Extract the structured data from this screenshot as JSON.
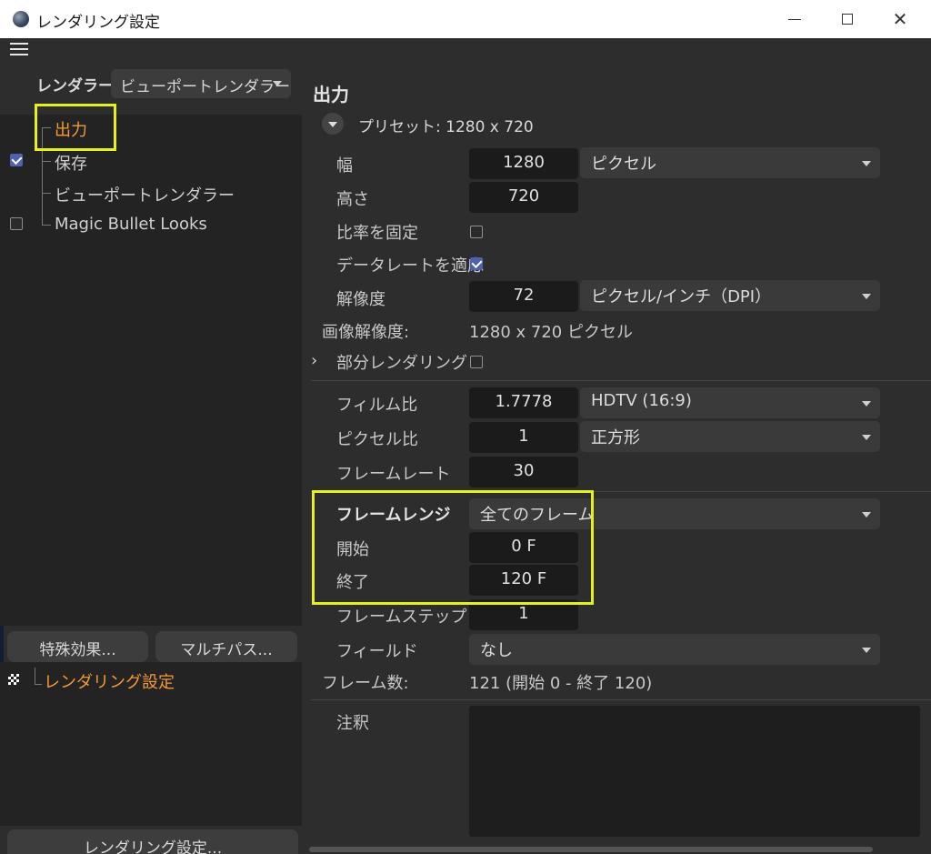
{
  "window": {
    "title": "レンダリング設定"
  },
  "renderer": {
    "label": "レンダラー",
    "value": "ビューポートレンダラー"
  },
  "tree": {
    "items": [
      {
        "label": "出力",
        "selected": true,
        "checkbox": null
      },
      {
        "label": "保存",
        "selected": false,
        "checkbox": true
      },
      {
        "label": "ビューポートレンダラー",
        "selected": false,
        "checkbox": null
      },
      {
        "label": "Magic Bullet Looks",
        "selected": false,
        "checkbox": false
      }
    ]
  },
  "left_buttons": {
    "effects": "特殊効果...",
    "multipass": "マルチパス..."
  },
  "lower_tree": {
    "item": "レンダリング設定"
  },
  "bottom_button": "レンダリング設定...",
  "output": {
    "title": "出力",
    "preset": "プリセット: 1280 x 720",
    "width": {
      "label": "幅",
      "value": "1280",
      "unit": "ピクセル"
    },
    "height": {
      "label": "高さ",
      "value": "720"
    },
    "lock_ratio": {
      "label": "比率を固定",
      "checked": false
    },
    "apply_datarate": {
      "label": "データレートを適応",
      "checked": true
    },
    "resolution": {
      "label": "解像度",
      "value": "72",
      "unit": "ピクセル/インチ（DPI）"
    },
    "image_resolution": {
      "label": "画像解像度:",
      "value": "1280 x 720 ピクセル"
    },
    "partial_render": {
      "label": "部分レンダリング",
      "checked": false
    },
    "film_aspect": {
      "label": "フィルム比",
      "value": "1.7778",
      "preset": "HDTV (16:9)"
    },
    "pixel_aspect": {
      "label": "ピクセル比",
      "value": "1",
      "preset": "正方形"
    },
    "frame_rate": {
      "label": "フレームレート",
      "value": "30"
    },
    "frame_range": {
      "label": "フレームレンジ",
      "value": "全てのフレーム"
    },
    "start": {
      "label": "開始",
      "value": "0 F"
    },
    "end": {
      "label": "終了",
      "value": "120 F"
    },
    "frame_step": {
      "label": "フレームステップ",
      "value": "1"
    },
    "field": {
      "label": "フィールド",
      "value": "なし"
    },
    "frame_count": {
      "label": "フレーム数:",
      "value": "121 (開始 0 - 終了 120)"
    },
    "notes": {
      "label": "注釈"
    }
  },
  "colors": {
    "highlight": "#e6f11c",
    "selected_text": "#f39a36",
    "checkbox_on": "#5061b0"
  }
}
